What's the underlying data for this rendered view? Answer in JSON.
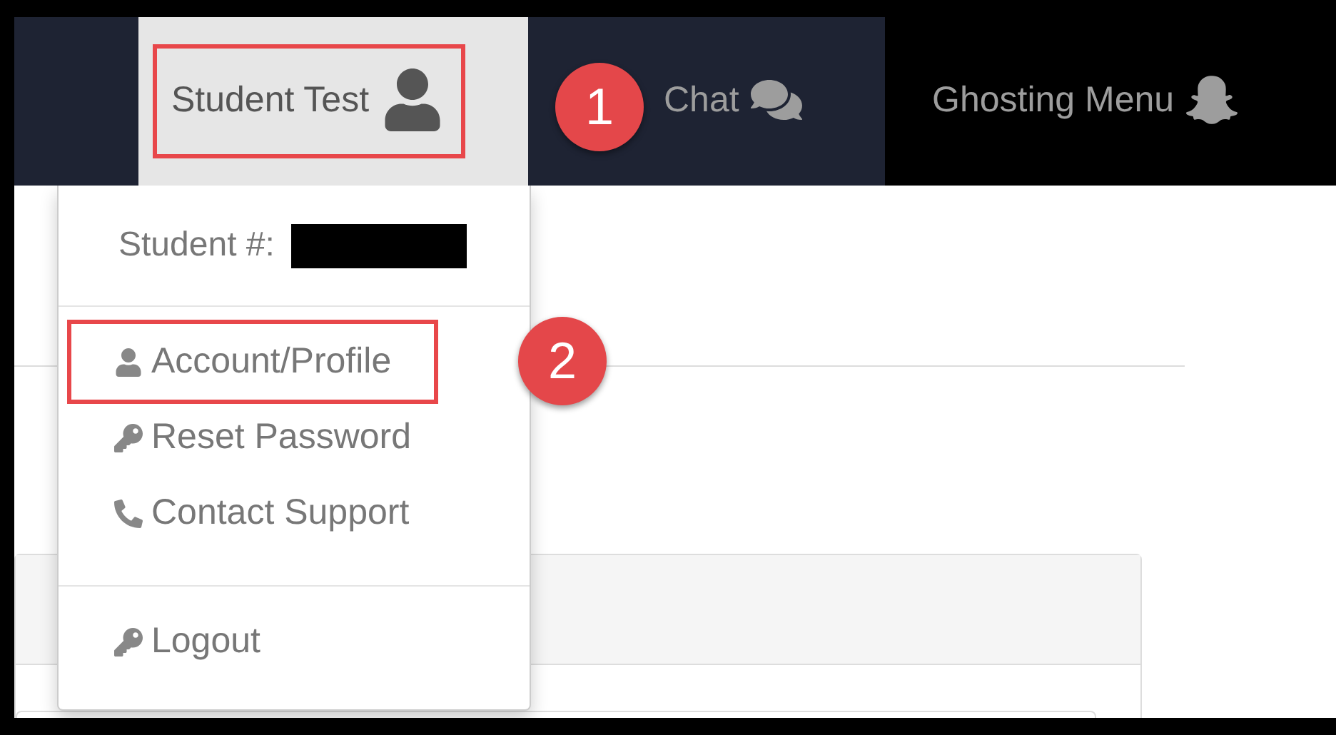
{
  "nav": {
    "items": [
      {
        "label": "Student Test",
        "highlighted": true,
        "callout": "1"
      },
      {
        "label": "Chat",
        "highlighted": false
      },
      {
        "label": "Ghosting Menu",
        "highlighted": false
      }
    ]
  },
  "dropdown": {
    "header": "Student #:",
    "sections": [
      [
        {
          "label": "Account/Profile",
          "highlighted": true,
          "callout": "2"
        },
        {
          "label": "Reset Password",
          "highlighted": false
        },
        {
          "label": "Contact Support",
          "highlighted": false
        }
      ],
      [
        {
          "label": "Logout",
          "highlighted": false
        }
      ]
    ]
  }
}
